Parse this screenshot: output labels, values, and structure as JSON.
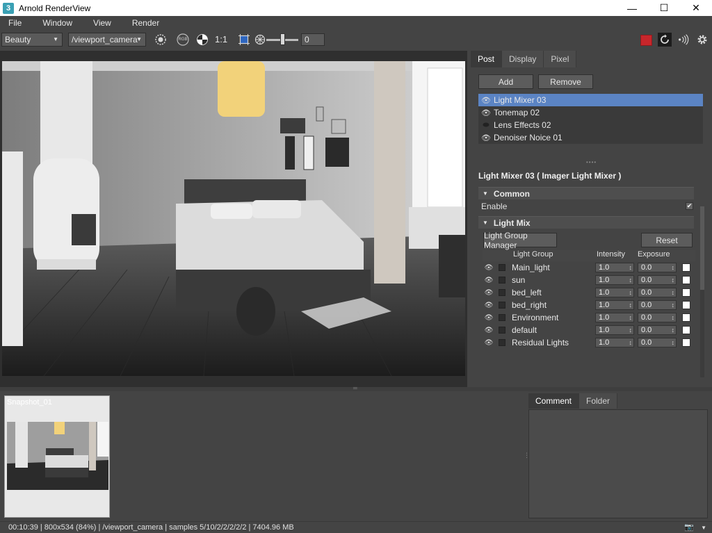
{
  "window": {
    "app_icon_glyph": "3",
    "title": "Arnold RenderView",
    "minimize_glyph": "—",
    "maximize_glyph": "☐",
    "close_glyph": "✕"
  },
  "menu": [
    "File",
    "Window",
    "View",
    "Render"
  ],
  "toolbar": {
    "aov_select": "Beauty",
    "camera_select": "/viewport_camera",
    "rgb_label": "RGB",
    "ratio_label": "1:1",
    "exposure_value": "0",
    "icons": [
      "render-region-icon",
      "rgb-channels-icon",
      "alpha-icon",
      "crop-region-icon",
      "exposure-icon",
      "stop-render-icon",
      "ipr-refresh-icon",
      "broadcast-icon",
      "settings-gear-icon"
    ],
    "colors": {
      "stop": "#c8262b",
      "accent": "#5b84c4"
    }
  },
  "right_panel": {
    "tabs": [
      "Post",
      "Display",
      "Pixel"
    ],
    "active_tab": "Post",
    "add_label": "Add",
    "remove_label": "Remove",
    "imagers": [
      {
        "name": "Light Mixer 03",
        "selected": true,
        "visible": true
      },
      {
        "name": "Tonemap 02",
        "selected": false,
        "visible": true
      },
      {
        "name": "Lens Effects 02",
        "selected": false,
        "visible": false
      },
      {
        "name": "Denoiser Noice 01",
        "selected": false,
        "visible": true
      }
    ],
    "properties_title": "Light Mixer 03  ( Imager Light Mixer )",
    "sections": {
      "common": "Common",
      "enable_label": "Enable",
      "enable_checked": true,
      "light_mix": "Light Mix"
    },
    "light_group_manager_label": "Light Group Manager",
    "reset_label": "Reset",
    "table_headers": {
      "group": "Light Group",
      "intensity": "Intensity",
      "exposure": "Exposure"
    },
    "light_groups": [
      {
        "name": "Main_light",
        "intensity": "1.0",
        "exposure": "0.0"
      },
      {
        "name": "sun",
        "intensity": "1.0",
        "exposure": "0.0"
      },
      {
        "name": "bed_left",
        "intensity": "1.0",
        "exposure": "0.0"
      },
      {
        "name": "bed_right",
        "intensity": "1.0",
        "exposure": "0.0"
      },
      {
        "name": "Environment",
        "intensity": "1.0",
        "exposure": "0.0"
      },
      {
        "name": "default",
        "intensity": "1.0",
        "exposure": "0.0"
      },
      {
        "name": "Residual Lights",
        "intensity": "1.0",
        "exposure": "0.0"
      }
    ]
  },
  "snapshots": [
    {
      "label": "Snapshot_01"
    }
  ],
  "comment_tabs": [
    "Comment",
    "Folder"
  ],
  "status": "00:10:39 | 800x534 (84%) | /viewport_camera  | samples 5/10/2/2/2/2/2 | 7404.96 MB"
}
